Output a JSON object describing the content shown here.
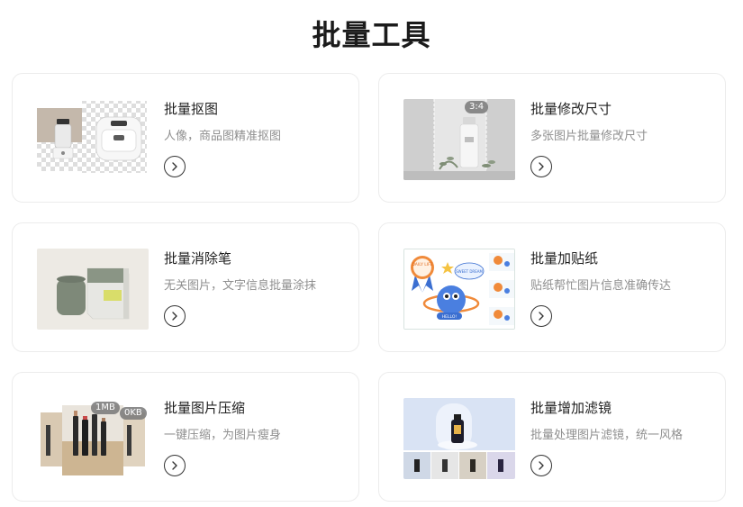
{
  "page": {
    "title": "批量工具"
  },
  "tools": [
    {
      "title": "批量抠图",
      "desc": "人像，商品图精准抠图"
    },
    {
      "title": "批量修改尺寸",
      "desc": "多张图片批量修改尺寸",
      "ratio_badge": "3:4"
    },
    {
      "title": "批量消除笔",
      "desc": "无关图片，文字信息批量涂抹"
    },
    {
      "title": "批量加贴纸",
      "desc": "贴纸帮忙图片信息准确传达",
      "stickers": [
        "DAILY LIFE",
        "SWEET DREAM",
        "HELLO!"
      ]
    },
    {
      "title": "批量图片压缩",
      "desc": "一键压缩，为图片瘦身",
      "size_tags": [
        "1MB",
        "0KB"
      ]
    },
    {
      "title": "批量增加滤镜",
      "desc": "批量处理图片滤镜，统一风格"
    }
  ],
  "icons": {
    "arrow": "chevron-right-icon"
  },
  "colors": {
    "border": "#ececec",
    "title": "#1f1f1f",
    "desc": "#8f8f8f",
    "background": "#ffffff"
  }
}
